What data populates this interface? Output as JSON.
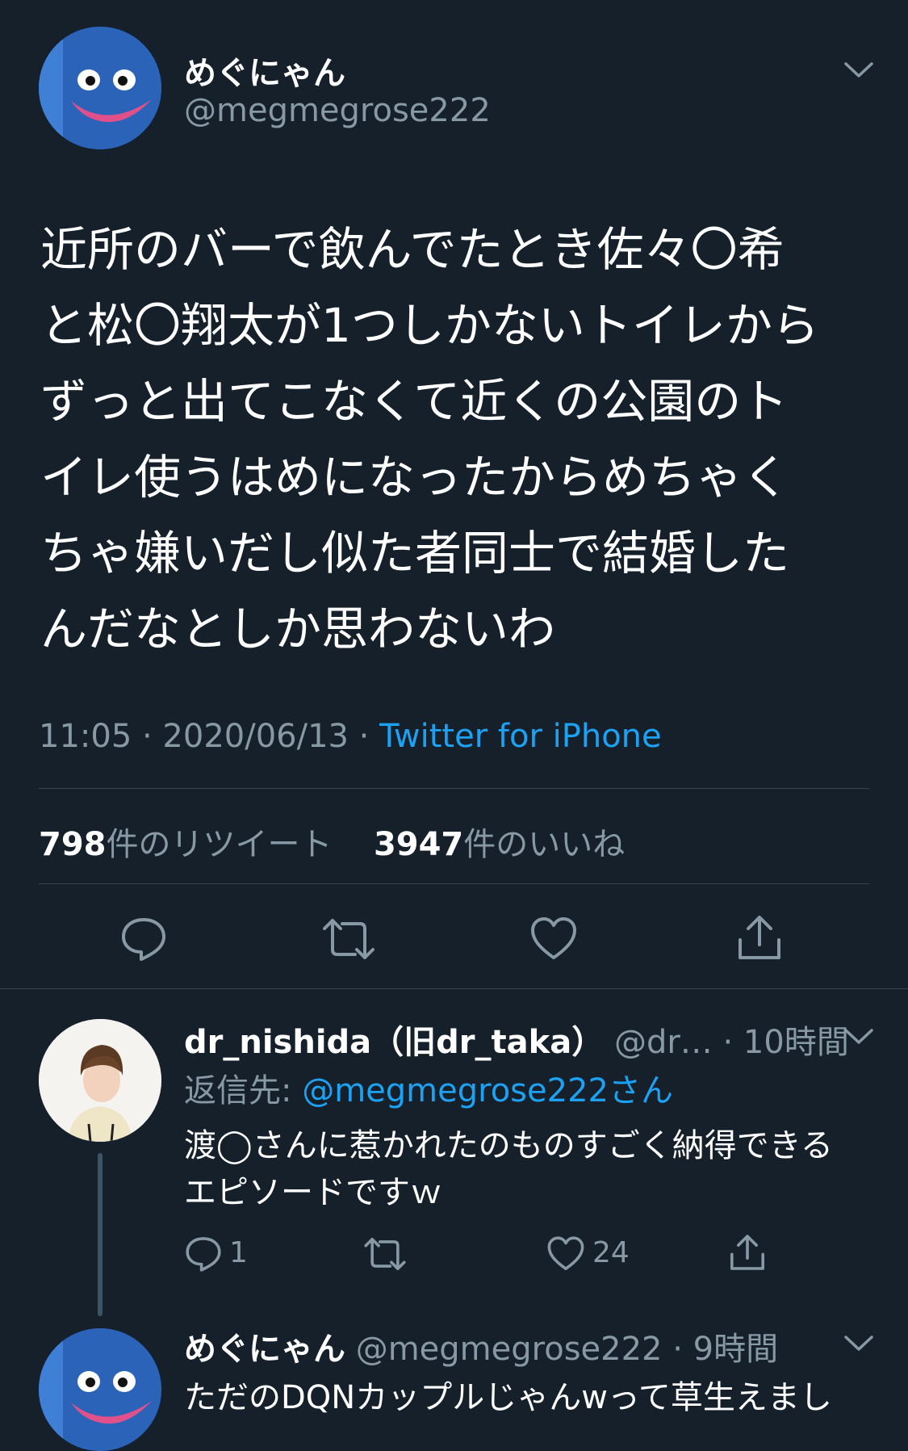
{
  "tweet": {
    "display_name": "めぐにゃん",
    "handle": "@megmegrose222",
    "text_lines": [
      "近所のバーで飲んでたとき佐々〇希",
      "と松〇翔太が1つしかないトイレから",
      "ずっと出てこなくて近くの公園のト",
      "イレ使うはめになったからめちゃく",
      "ちゃ嫌いだし似た者同士で結婚した",
      "んだなとしか思わないわ"
    ],
    "time": "11:05 · 2020/06/13 · ",
    "source": "Twitter for iPhone",
    "retweet_count": "798",
    "retweet_label": "件のリツイート",
    "like_count": "3947",
    "like_label": "件のいいね",
    "actions": [
      "reply-icon",
      "retweet-icon",
      "like-icon",
      "share-icon"
    ]
  },
  "reply1": {
    "display_name": "dr_nishida（旧dr_taka）",
    "handle_time": "@dr… · 10時間",
    "reply_prefix": "返信先: ",
    "reply_to": "@megmegrose222さん",
    "text_lines": [
      "渡◯さんに惹かれたのものすごく納得できる",
      "エピソードですｗ"
    ],
    "reply_count": "1",
    "like_count": "24"
  },
  "reply2": {
    "display_name": "めぐにゃん",
    "handle_time": "@megmegrose222 · 9時間",
    "text_line": "ただのDQNカップルじゃんwって草生えまし"
  },
  "colors": {
    "background": "#15202b",
    "text": "#ffffff",
    "muted": "#8899a6",
    "accent": "#1da1f2",
    "divider": "#38444d"
  }
}
